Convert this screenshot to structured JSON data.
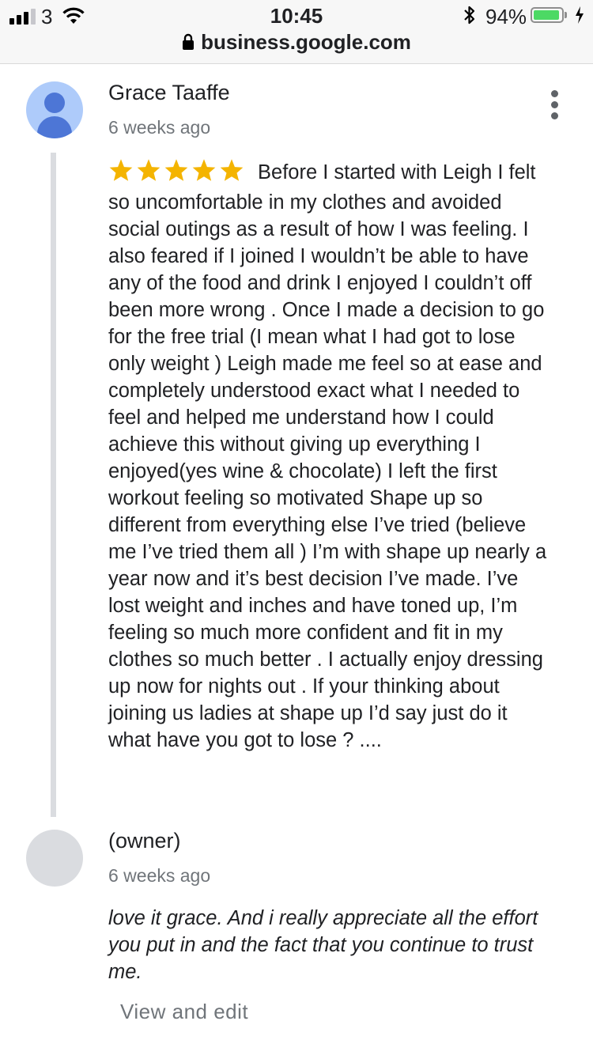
{
  "status_bar": {
    "carrier": "3",
    "time": "10:45",
    "battery_percent": "94%",
    "battery_level": 0.94,
    "icons": [
      "signal-icon",
      "wifi-icon",
      "bluetooth-icon",
      "battery-icon",
      "charging-icon"
    ]
  },
  "browser": {
    "url": "business.google.com",
    "lock_icon": "lock-icon"
  },
  "review": {
    "reviewer_name": "Grace Taaffe",
    "time_ago": "6 weeks ago",
    "rating": 5,
    "star_color": "#f4b400",
    "text": "Before I started with Leigh I felt so uncomfortable in my clothes and avoided social outings as a result of how I was feeling. I also feared if I joined I wouldn’t be able to have any of the food and drink I enjoyed I couldn’t off been more wrong . Once I made a decision to go for the free trial (I mean what I had got to lose only weight ) Leigh made me feel so at ease and completely understood exact what I needed to feel and helped me understand how I could achieve this without giving up everything I enjoyed(yes wine & chocolate) I left the first workout feeling so motivated Shape up so different from everything else I’ve tried (believe me I’ve tried them all ) I’m with shape up nearly a year now and it’s best decision I’ve made. I’ve lost weight and inches and have toned up, I’m feeling so much more confident and fit in my clothes so much better . I actually enjoy dressing up now for nights out . If your thinking about joining us ladies at shape up I’d say just do it what have you got to lose ? ...."
  },
  "owner_reply": {
    "name": "(owner)",
    "time_ago": "6 weeks ago",
    "text": "love it grace. And i really appreciate all the effort you put in and the fact that you continue to trust me.",
    "action_label": "View and edit"
  }
}
